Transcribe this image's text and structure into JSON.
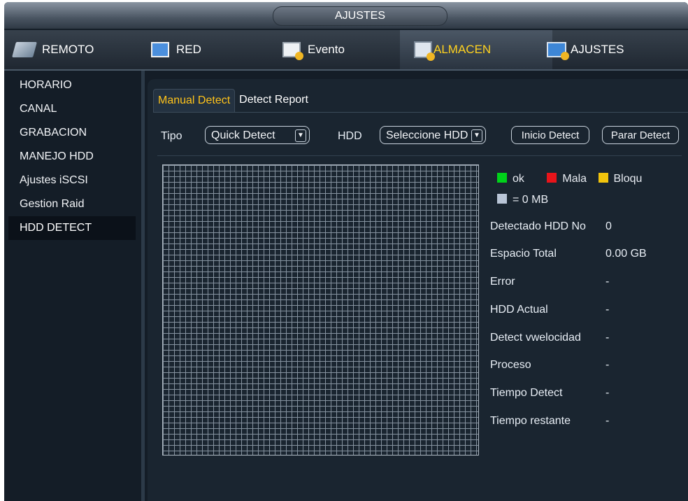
{
  "window": {
    "title": "AJUSTES"
  },
  "top_tabs": [
    {
      "label": "REMOTO",
      "icon": "remote-camera-icon"
    },
    {
      "label": "RED",
      "icon": "network-icon"
    },
    {
      "label": "Evento",
      "icon": "event-icon"
    },
    {
      "label": "ALMACEN",
      "icon": "storage-icon",
      "active": true
    },
    {
      "label": "AJUSTES",
      "icon": "settings-icon"
    }
  ],
  "sidebar": {
    "items": [
      {
        "label": "HORARIO"
      },
      {
        "label": "CANAL"
      },
      {
        "label": "GRABACION"
      },
      {
        "label": "MANEJO HDD"
      },
      {
        "label": "Ajustes iSCSI"
      },
      {
        "label": "Gestion Raid"
      },
      {
        "label": "HDD DETECT",
        "active": true
      }
    ]
  },
  "subtabs": [
    {
      "label": "Manual Detect",
      "active": true
    },
    {
      "label": "Detect Report"
    }
  ],
  "controls": {
    "tipo_label": "Tipo",
    "tipo_value": "Quick Detect",
    "hdd_label": "HDD",
    "hdd_value": "Seleccione HDD",
    "start_button": "Inicio Detect",
    "stop_button": "Parar Detect"
  },
  "legend": {
    "ok": "ok",
    "mala": "Mala",
    "bloqu": "Bloqu",
    "unit": "= 0 MB",
    "colors": {
      "ok": "#00d21a",
      "mala": "#e8141a",
      "bloqu": "#f2c40c",
      "unit": "#b9c5d6"
    }
  },
  "info": [
    {
      "label": "Detectado HDD No",
      "value": "0"
    },
    {
      "label": "Espacio Total",
      "value": "0.00 GB"
    },
    {
      "label": "Error",
      "value": "-"
    },
    {
      "label": "HDD Actual",
      "value": "-"
    },
    {
      "label": "Detect vwelocidad",
      "value": "-"
    },
    {
      "label": "Proceso",
      "value": "-"
    },
    {
      "label": "Tiempo Detect",
      "value": "-"
    },
    {
      "label": "Tiempo restante",
      "value": "-"
    }
  ],
  "colors": {
    "accent": "#ffc31a",
    "background": "#141d27"
  }
}
